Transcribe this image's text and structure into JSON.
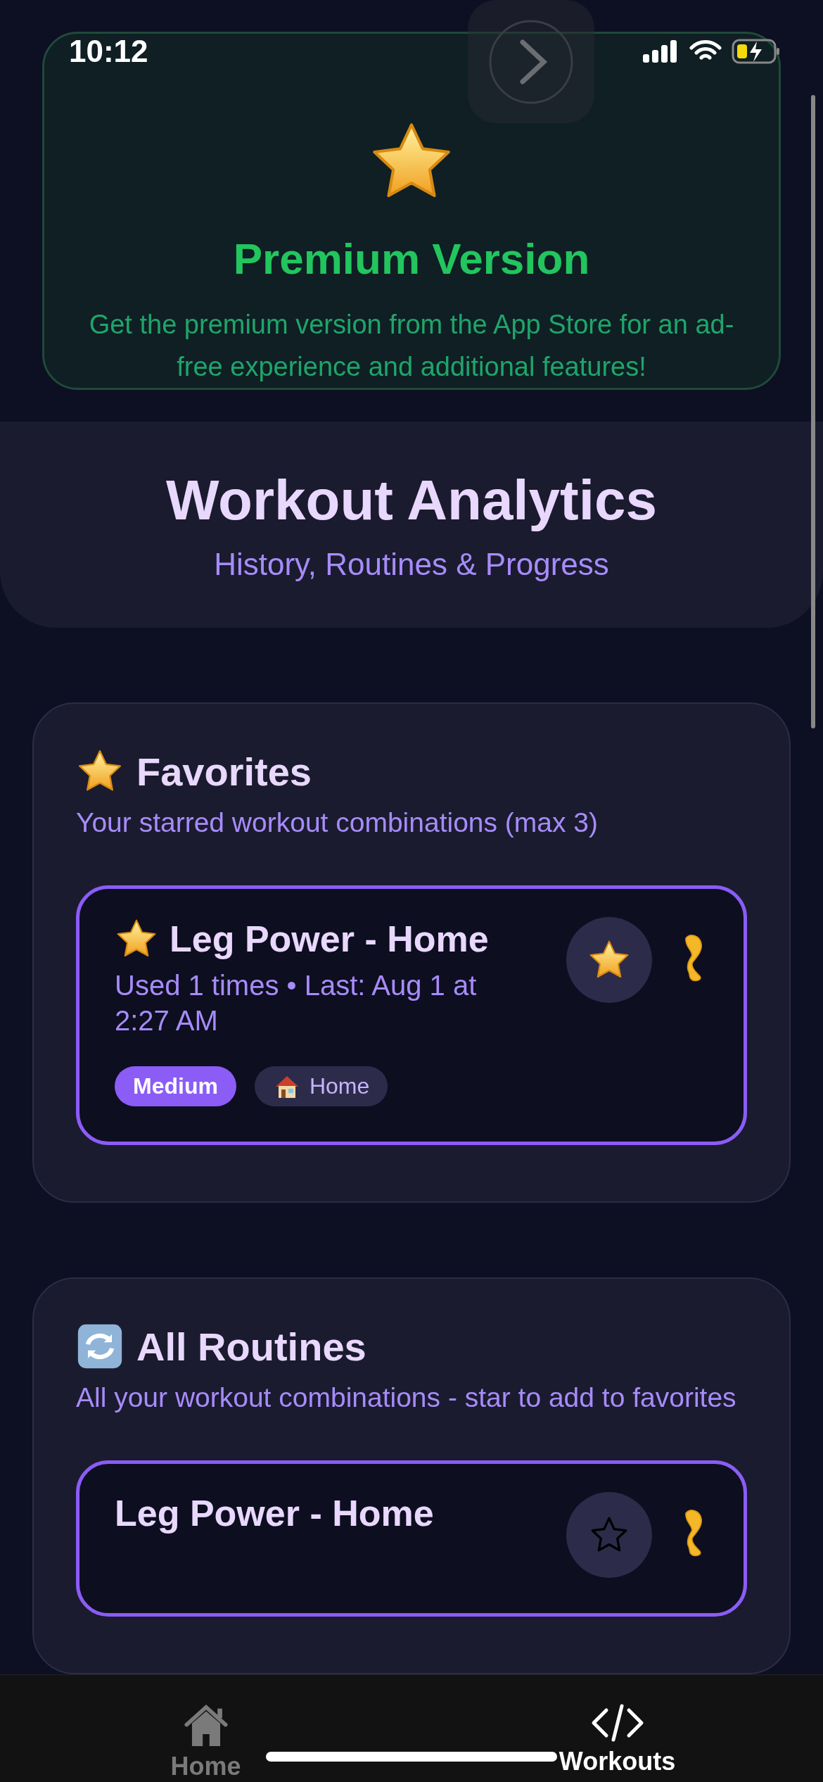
{
  "status_bar": {
    "time": "10:12"
  },
  "premium": {
    "title": "Premium Version",
    "text": "Get the premium version from the App Store for an ad-free experience and additional features!"
  },
  "header": {
    "title": "Workout Analytics",
    "subtitle": "History, Routines & Progress"
  },
  "sections": [
    {
      "kind": "favorites",
      "title": "Favorites",
      "subtitle": "Your starred workout combinations (max 3)",
      "routines": [
        {
          "title": "Leg Power - Home",
          "starred": true,
          "meta": "Used 1 times • Last: Aug 1 at 2:27 AM",
          "tags": [
            {
              "kind": "difficulty",
              "label": "Medium"
            },
            {
              "kind": "location",
              "label": "Home"
            }
          ]
        }
      ]
    },
    {
      "kind": "all",
      "title": "All Routines",
      "subtitle": "All your workout combinations - star to add to favorites",
      "routines": [
        {
          "title": "Leg Power - Home",
          "starred": false
        }
      ]
    }
  ],
  "tabs": [
    {
      "label": "Home",
      "kind": "home",
      "selected": false
    },
    {
      "label": "Workouts",
      "kind": "code",
      "selected": true
    }
  ]
}
